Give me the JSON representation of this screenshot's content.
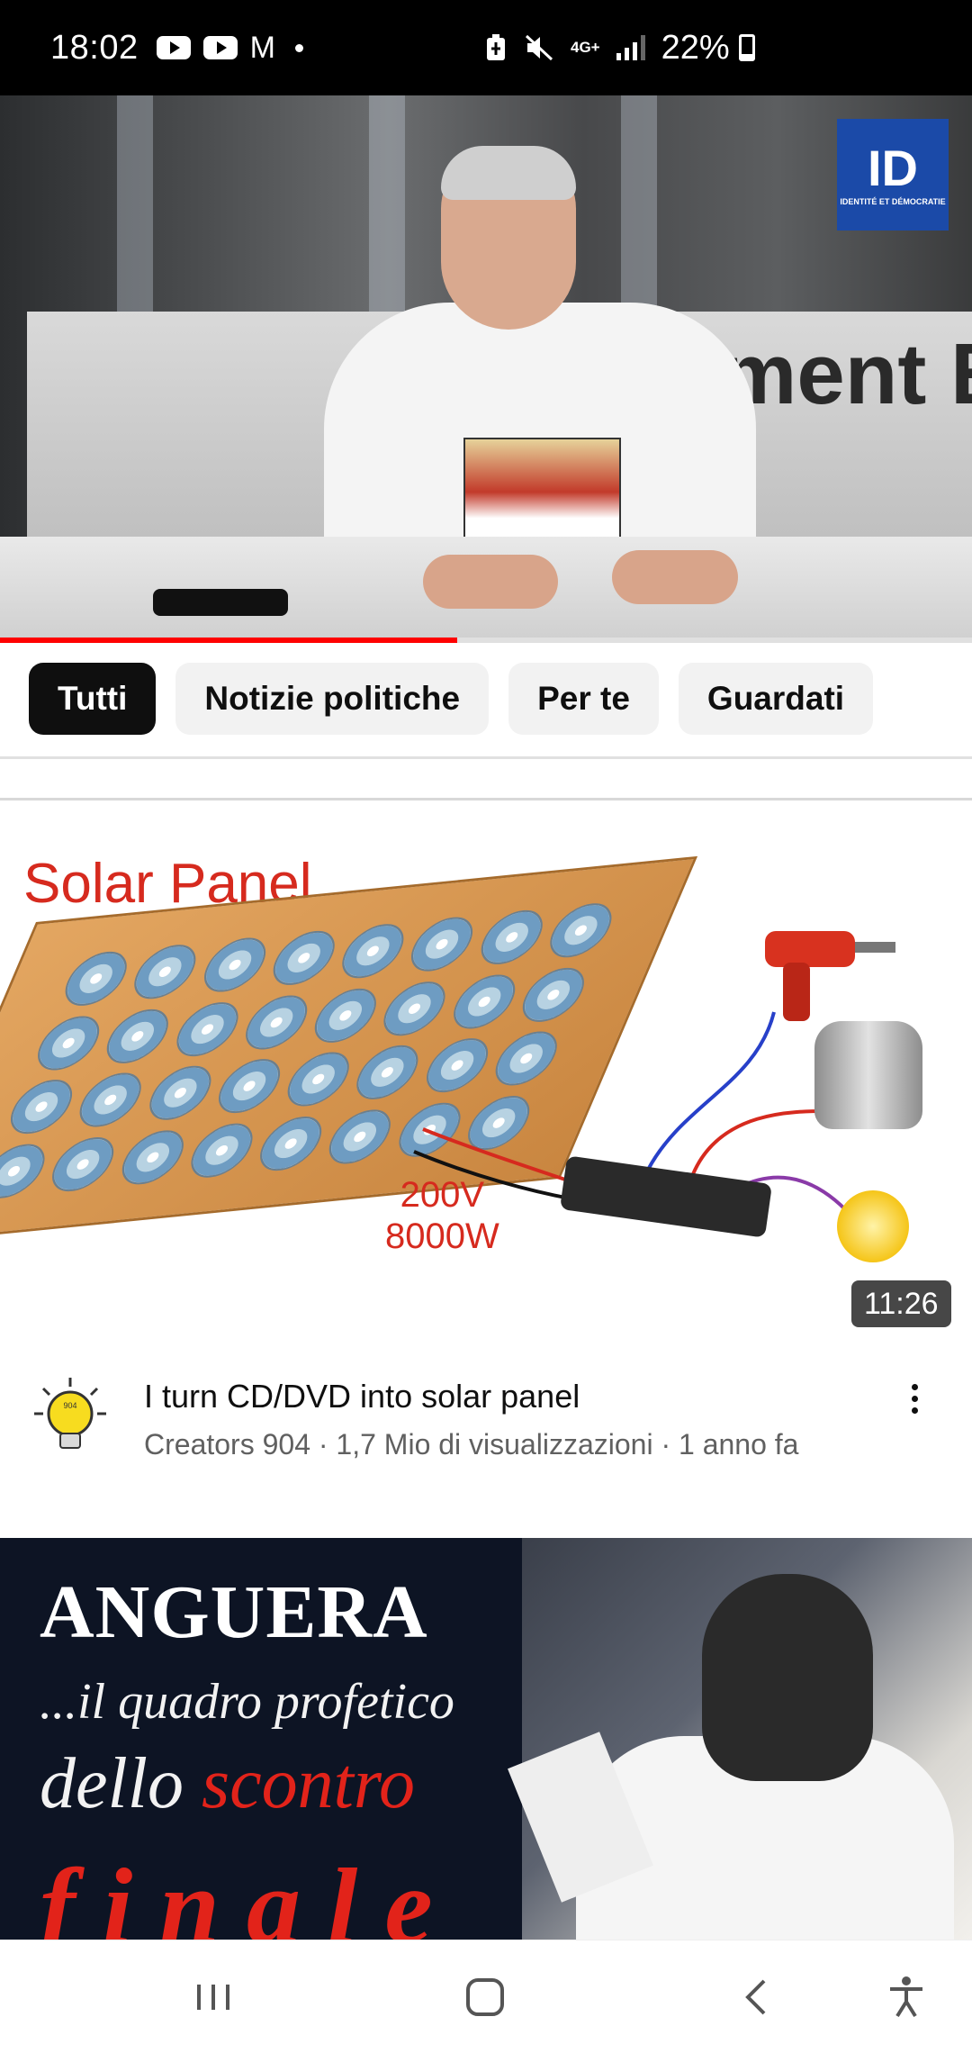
{
  "status_bar": {
    "time": "18:02",
    "notification_icons": [
      "youtube-icon",
      "youtube-icon",
      "gmail-icon",
      "dot-icon"
    ],
    "network_label": "4G+",
    "battery_percent": "22%",
    "battery_level": 0.22
  },
  "player": {
    "overlay_text": "ment E",
    "logo": {
      "mark": "ID",
      "sub": "IDENTITÉ ET DÉMOCRATIE"
    },
    "progress": 0.47
  },
  "chips": [
    {
      "label": "Tutti",
      "active": true
    },
    {
      "label": "Notizie politiche",
      "active": false
    },
    {
      "label": "Per te",
      "active": false
    },
    {
      "label": "Guardati",
      "active": false
    }
  ],
  "videos": [
    {
      "thumbnail": {
        "title": "Solar Panel",
        "power_line1": "200V",
        "power_line2": "8000W"
      },
      "duration": "11:26",
      "title": "I turn CD/DVD into solar panel",
      "subtitle": "Creators 904 · 1,7 Mio di visualizzazioni · 1 anno fa",
      "channel_avatar": {
        "icon": "lightbulb-icon",
        "text": "904"
      }
    },
    {
      "thumbnail": {
        "line1": "ANGUERA",
        "line2": "...il quadro profetico",
        "line3_a": "dello",
        "line3_b": "scontro",
        "line4": "finale"
      }
    }
  ],
  "nav_bar": {
    "icons": [
      "recent-apps-icon",
      "home-icon",
      "back-icon",
      "accessibility-icon"
    ]
  },
  "colors": {
    "accent_red": "#ff0000",
    "chip_active_bg": "#0f0f0f",
    "chip_bg": "#f2f2f2",
    "secondary_text": "#606060"
  }
}
